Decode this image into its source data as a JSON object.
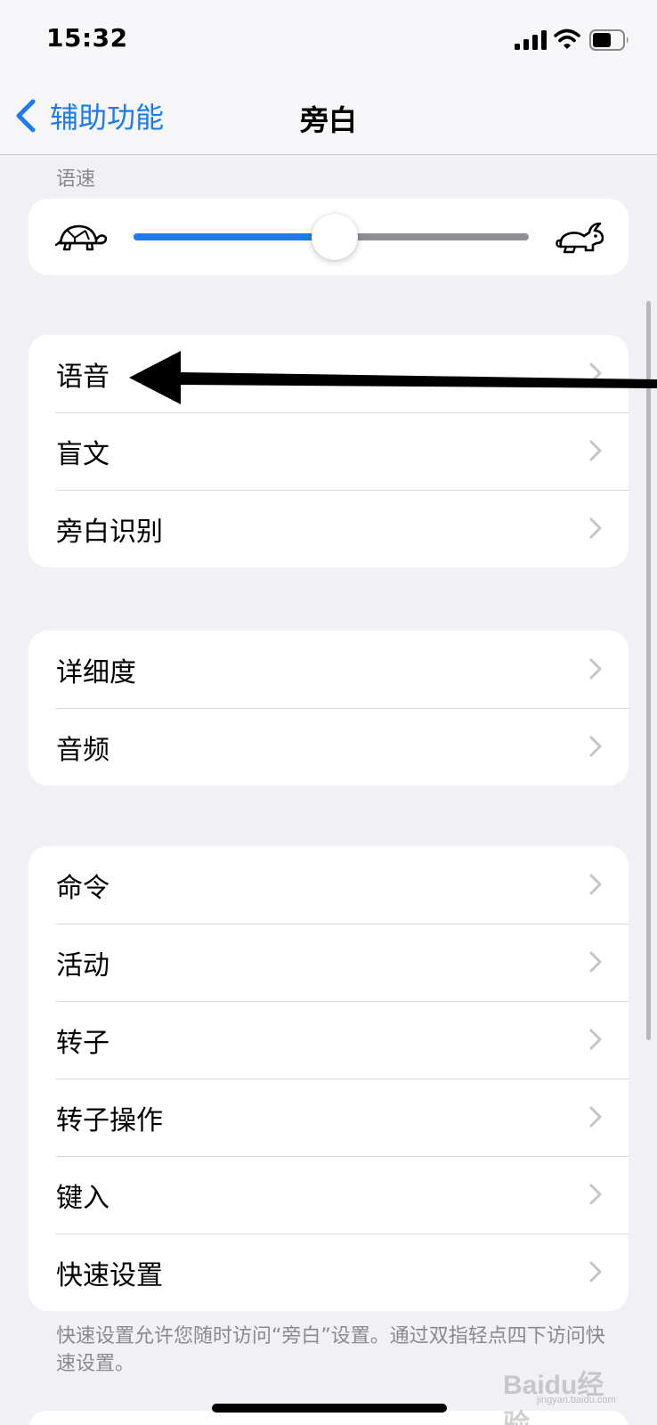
{
  "status_bar": {
    "time": "15:32"
  },
  "nav": {
    "back_label": "辅助功能",
    "title": "旁白"
  },
  "speaking_rate": {
    "header": "语速",
    "value_fraction": 0.51
  },
  "groups": [
    {
      "rows": [
        {
          "label": "语音"
        },
        {
          "label": "盲文"
        },
        {
          "label": "旁白识别"
        }
      ]
    },
    {
      "rows": [
        {
          "label": "详细度"
        },
        {
          "label": "音频"
        }
      ]
    },
    {
      "rows": [
        {
          "label": "命令"
        },
        {
          "label": "活动"
        },
        {
          "label": "转子"
        },
        {
          "label": "转子操作"
        },
        {
          "label": "键入"
        },
        {
          "label": "快速设置"
        }
      ]
    }
  ],
  "footer_note": "快速设置允许您随时访问“旁白”设置。通过双指轻点四下访问快速设置。",
  "watermark": {
    "logo": "Baidu经验",
    "sub": "jingyan.baidu.com"
  },
  "colors": {
    "accent": "#1a7cf0",
    "background": "#f0f0f5",
    "card": "#ffffff",
    "secondary_text": "#8a8a8e"
  },
  "icons": {
    "back": "chevron-left-icon",
    "row_disclosure": "chevron-right-icon",
    "slow": "turtle-icon",
    "fast": "rabbit-icon",
    "signal": "cellular-signal-icon",
    "wifi": "wifi-icon",
    "battery": "battery-icon"
  }
}
